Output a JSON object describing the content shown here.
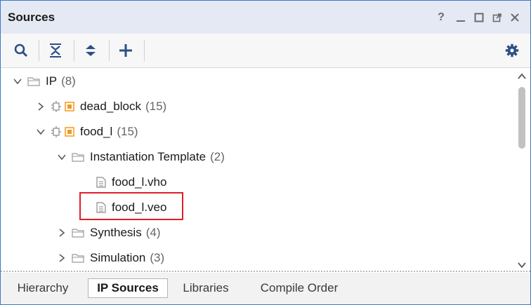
{
  "panel": {
    "title": "Sources"
  },
  "window_controls": [
    {
      "name": "help-icon",
      "glyph": "?"
    },
    {
      "name": "minimize-icon",
      "glyph": "–"
    },
    {
      "name": "maximize-icon",
      "glyph": "☐"
    },
    {
      "name": "float-icon",
      "glyph": "⧉"
    },
    {
      "name": "close-icon",
      "glyph": "✕"
    }
  ],
  "toolbar": {
    "icons": [
      "search-icon",
      "collapse-all-icon",
      "expand-all-icon",
      "add-sources-icon",
      "settings-icon"
    ]
  },
  "tree": {
    "ip": {
      "label": "IP",
      "count": "(8)"
    },
    "dead_block": {
      "label": "dead_block",
      "count": "(15)"
    },
    "food_l": {
      "label": "food_l",
      "count": "(15)"
    },
    "inst_template": {
      "label": "Instantiation Template",
      "count": "(2)"
    },
    "vho": {
      "label": "food_l.vho"
    },
    "veo": {
      "label": "food_l.veo"
    },
    "synthesis": {
      "label": "Synthesis",
      "count": "(4)"
    },
    "simulation": {
      "label": "Simulation",
      "count": "(3)"
    }
  },
  "tabs": [
    {
      "label": "Hierarchy",
      "active": false
    },
    {
      "label": "IP Sources",
      "active": true
    },
    {
      "label": "Libraries",
      "active": false
    },
    {
      "label": "Compile Order",
      "active": false
    }
  ],
  "colors": {
    "accent_border": "#3c79c4",
    "highlight": "#e01f26",
    "ip_core": "#f29a1c",
    "icon_blue": "#2c4f87"
  }
}
